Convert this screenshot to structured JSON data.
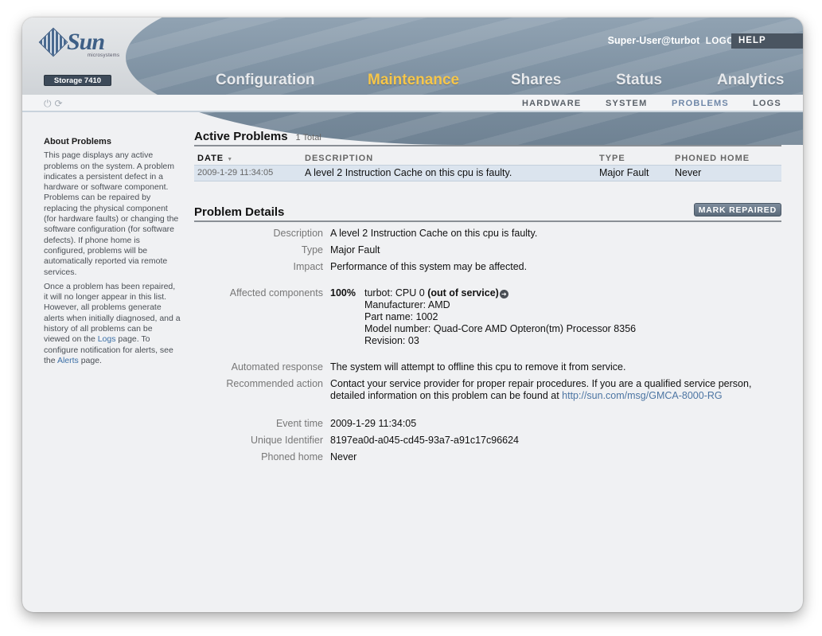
{
  "header": {
    "logo_text": "Sun",
    "logo_sub": "microsystems",
    "product": "Storage 7410",
    "user": "Super-User@turbot",
    "logout": "LOGOUT",
    "help": "HELP"
  },
  "main_nav": [
    {
      "label": "Configuration",
      "active": false
    },
    {
      "label": "Maintenance",
      "active": true
    },
    {
      "label": "Shares",
      "active": false
    },
    {
      "label": "Status",
      "active": false
    },
    {
      "label": "Analytics",
      "active": false
    }
  ],
  "sub_nav": {
    "icons": [
      "power-icon",
      "refresh-icon"
    ],
    "tabs": [
      {
        "label": "HARDWARE",
        "active": false
      },
      {
        "label": "SYSTEM",
        "active": false
      },
      {
        "label": "PROBLEMS",
        "active": true
      },
      {
        "label": "LOGS",
        "active": false
      }
    ]
  },
  "sidebar": {
    "title": "About Problems",
    "para1": "This page displays any active problems on the system. A problem indicates a persistent defect in a hardware or software component. Problems can be repaired by replacing the physical component (for hardware faults) or changing the software configuration (for software defects). If phone home is configured, problems will be automatically reported via remote services.",
    "para2_a": "Once a problem has been repaired, it will no longer appear in this list. However, all problems generate alerts when initially diagnosed, and a history of all problems can be viewed on the ",
    "logs_link": "Logs",
    "para2_b": " page. To configure notification for alerts, see the ",
    "alerts_link": "Alerts",
    "para2_c": " page."
  },
  "active_problems": {
    "title": "Active Problems",
    "total": "1 Total",
    "columns": {
      "date": "DATE",
      "sort_indicator": "▼",
      "description": "DESCRIPTION",
      "type": "TYPE",
      "phoned_home": "PHONED HOME"
    },
    "rows": [
      {
        "date": "2009-1-29 11:34:05",
        "description": "A level 2 Instruction Cache on this cpu is faulty.",
        "type": "Major Fault",
        "phoned_home": "Never"
      }
    ]
  },
  "details": {
    "title": "Problem Details",
    "mark_repaired": "MARK REPAIRED",
    "labels": {
      "description": "Description",
      "type": "Type",
      "impact": "Impact",
      "affected": "Affected components",
      "automated": "Automated response",
      "recommended": "Recommended action",
      "event_time": "Event time",
      "uuid": "Unique Identifier",
      "phoned_home": "Phoned home"
    },
    "description": "A level 2 Instruction Cache on this cpu is faulty.",
    "type": "Major Fault",
    "impact": "Performance of this system may be affected.",
    "affected": {
      "percent": "100%",
      "component_prefix": "turbot: CPU 0 ",
      "component_status": "(out of service)",
      "manufacturer": "Manufacturer: AMD",
      "part_name": "Part name: 1002",
      "model_number": "Model number: Quad-Core AMD Opteron(tm) Processor 8356",
      "revision": "Revision: 03"
    },
    "automated": "The system will attempt to offline this cpu to remove it from service.",
    "recommended_text": "Contact your service provider for proper repair procedures. If you are a qualified service person, detailed information on this problem can be found at ",
    "recommended_link": "http://sun.com/msg/GMCA-8000-RG",
    "event_time": "2009-1-29 11:34:05",
    "uuid": "8197ea0d-a045-cd45-93a7-a91c17c96624",
    "phoned_home": "Never"
  }
}
